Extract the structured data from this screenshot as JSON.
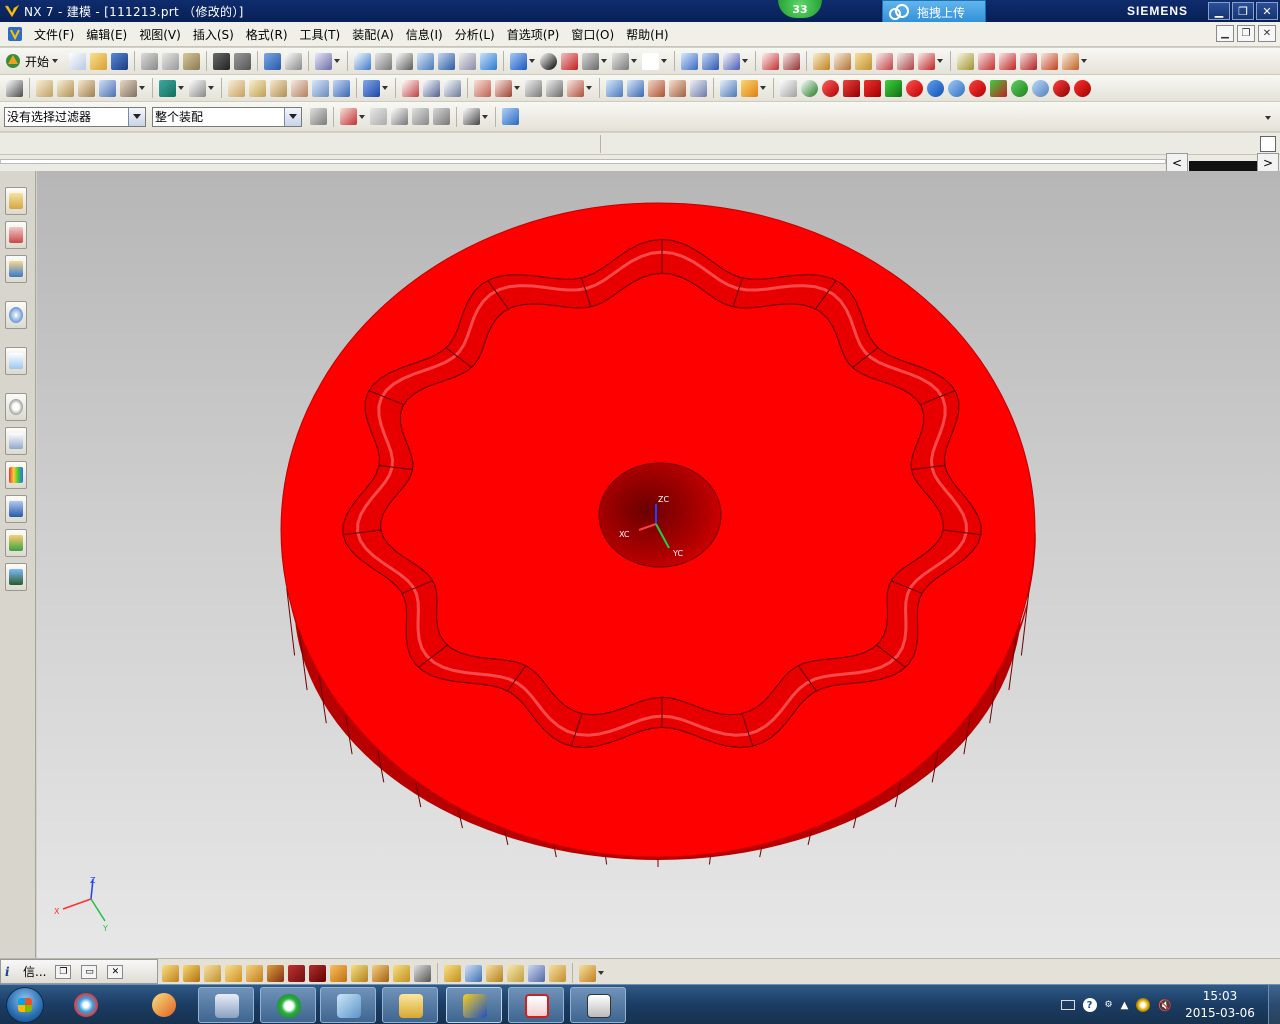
{
  "window": {
    "title": "NX 7 - 建模 - [111213.prt （修改的）]",
    "brand": "SIEMENS",
    "badge": "33",
    "upload_label": "拖拽上传"
  },
  "menu": {
    "items": [
      {
        "label": "文件(F)",
        "name": "menu-file"
      },
      {
        "label": "编辑(E)",
        "name": "menu-edit"
      },
      {
        "label": "视图(V)",
        "name": "menu-view"
      },
      {
        "label": "插入(S)",
        "name": "menu-insert"
      },
      {
        "label": "格式(R)",
        "name": "menu-format"
      },
      {
        "label": "工具(T)",
        "name": "menu-tools"
      },
      {
        "label": "装配(A)",
        "name": "menu-assembly"
      },
      {
        "label": "信息(I)",
        "name": "menu-info"
      },
      {
        "label": "分析(L)",
        "name": "menu-analysis"
      },
      {
        "label": "首选项(P)",
        "name": "menu-preferences"
      },
      {
        "label": "窗口(O)",
        "name": "menu-window"
      },
      {
        "label": "帮助(H)",
        "name": "menu-help"
      }
    ]
  },
  "toolbar": {
    "start_label": "开始",
    "filter_value": "没有选择过滤器",
    "scope_value": "整个装配"
  },
  "viewport": {
    "triad_labels": {
      "zc": "ZC",
      "xc": "XC",
      "yc": "YC"
    },
    "mini_axes": {
      "z": "Z",
      "x": "X",
      "y": "Y"
    },
    "part_color": "#ff0000"
  },
  "info_window": {
    "label": "信..."
  },
  "taskbar": {
    "time": "15:03",
    "date": "2015-03-06"
  },
  "colors": {
    "accent_blue": "#0f2c6e",
    "part_red": "#ff0000",
    "part_side": "#b00000"
  }
}
